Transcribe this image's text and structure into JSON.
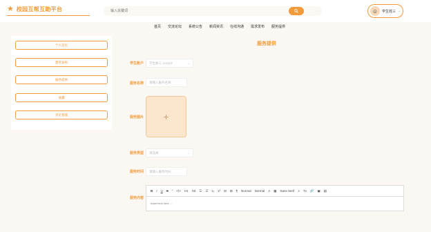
{
  "header": {
    "logo_text": "校园互帮互助平台",
    "search_placeholder": "输入关键词",
    "user_name": "学生姓三"
  },
  "nav": [
    "首页",
    "交流论坛",
    "系统公告",
    "新闻资讯",
    "在线沟通",
    "需求发布",
    "服务提供"
  ],
  "sidebar": {
    "items": [
      "个人首页",
      "需求发布",
      "服务提供",
      "收藏",
      "评论管理"
    ]
  },
  "form": {
    "title": "服务提供",
    "fields": {
      "student_account_label": "学生账户",
      "student_account_value": "学生账三 sss123",
      "service_name_label": "服务名称",
      "service_name_placeholder": "请输入服务名称",
      "service_image_label": "服务图片",
      "service_type_label": "服务类型",
      "service_type_placeholder": "请选择",
      "service_time_label": "服务时间",
      "service_time_placeholder": "请输入服务时间",
      "service_content_label": "服务内容"
    }
  },
  "editor": {
    "toolbar": [
      "B",
      "I",
      "U",
      "S",
      "”",
      "</>",
      "H1",
      "H2",
      "☰",
      "☰",
      "x₂",
      "x²",
      "⊟",
      "⊞",
      "¶",
      "Normal",
      "Normal",
      "A",
      "▦",
      "Sans Serif",
      "≡",
      "Tx",
      "🔗",
      "▣",
      "▤"
    ],
    "placeholder": "Insert text here ..."
  },
  "colors": {
    "accent": "#f39b3b",
    "background": "#fbf7f2"
  }
}
